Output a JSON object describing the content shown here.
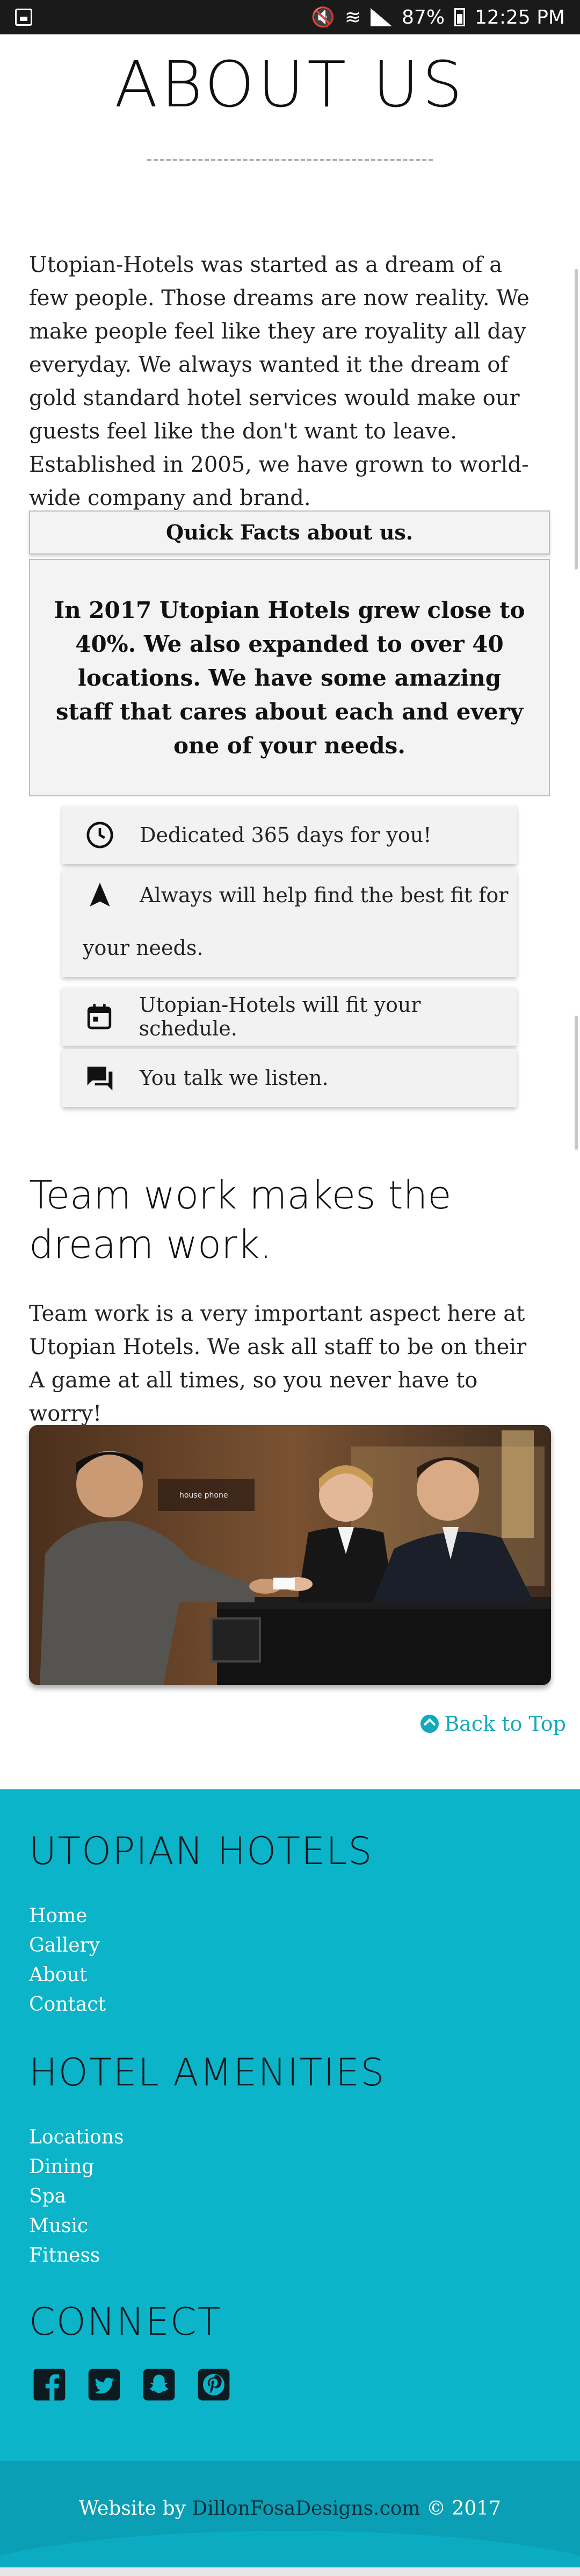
{
  "status_bar": {
    "battery": "87%",
    "time": "12:25 PM"
  },
  "page": {
    "title": "ABOUT US",
    "intro": "Utopian-Hotels was started as a dream of a few people. Those dreams are now reality. We make people feel like they are royality all day everyday. We always wanted it the dream of gold standard hotel services would make our guests feel like the don't want to leave. Established in 2005, we have grown to world-wide company and brand."
  },
  "quick_facts": {
    "heading": "Quick Facts about us.",
    "body": "In 2017 Utopian Hotels grew close to 40%. We also expanded to over 40 locations. We have some amazing staff that cares about each and every one of your needs."
  },
  "features": [
    {
      "icon": "clock-icon",
      "text": "Dedicated 365 days for you!"
    },
    {
      "icon": "navigation-arrow-icon",
      "text_line1": "Always will help find the best fit for",
      "text_line2": "your needs."
    },
    {
      "icon": "calendar-icon",
      "text": "Utopian-Hotels will fit your schedule."
    },
    {
      "icon": "chat-icon",
      "text": "You talk we listen."
    }
  ],
  "team": {
    "heading": "Team work makes the dream work.",
    "body": "Team work is a very important aspect here at Utopian Hotels. We ask all staff to be on their A game at all times, so you never have to worry!",
    "photo_sign_text": "house phone"
  },
  "back_to_top": "Back to Top",
  "footer": {
    "brand_heading": "UTOPIAN HOTELS",
    "nav": [
      "Home",
      "Gallery",
      "About",
      "Contact"
    ],
    "amenities_heading": "HOTEL AMENITIES",
    "amenities": [
      "Locations",
      "Dining",
      "Spa",
      "Music",
      "Fitness"
    ],
    "connect_heading": "CONNECT",
    "social": [
      "facebook-icon",
      "twitter-icon",
      "snapchat-icon",
      "pinterest-icon"
    ],
    "credit_prefix": "Website by ",
    "credit_link": "DillonFosaDesigns.com",
    "credit_suffix": " © 2017",
    "bg_color": "#0bb4c8"
  },
  "colors": {
    "accent": "#15a8bb",
    "footer_bg": "#0bb4c8"
  }
}
